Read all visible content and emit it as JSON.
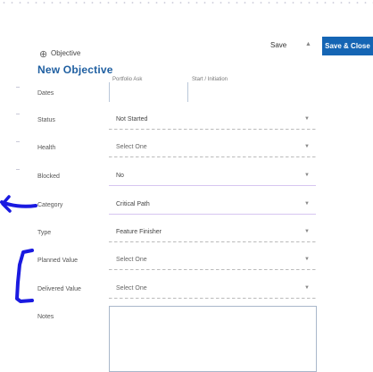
{
  "header": {
    "section_label": "Objective",
    "title": "New Objective",
    "save_label": "Save",
    "save_close_label": "Save & Close"
  },
  "dates": {
    "col1_header": "Portfolio Ask",
    "col2_header": "Start / Initiation"
  },
  "fields": {
    "dates_label": "Dates",
    "status_label": "Status",
    "status_value": "Not Started",
    "health_label": "Health",
    "health_value": "Select One",
    "blocked_label": "Blocked",
    "blocked_value": "No",
    "category_label": "Category",
    "category_value": "Critical Path",
    "type_label": "Type",
    "type_value": "Feature Finisher",
    "planned_label": "Planned Value",
    "planned_value": "Select One",
    "delivered_label": "Delivered Value",
    "delivered_value": "Select One",
    "notes_label": "Notes"
  },
  "icons": {
    "objective": "move-arrows-icon",
    "caret": "triangle-down-icon"
  },
  "colors": {
    "accent": "#1565b4",
    "title": "#1f5fa1",
    "annotation": "#1a1ae0"
  }
}
